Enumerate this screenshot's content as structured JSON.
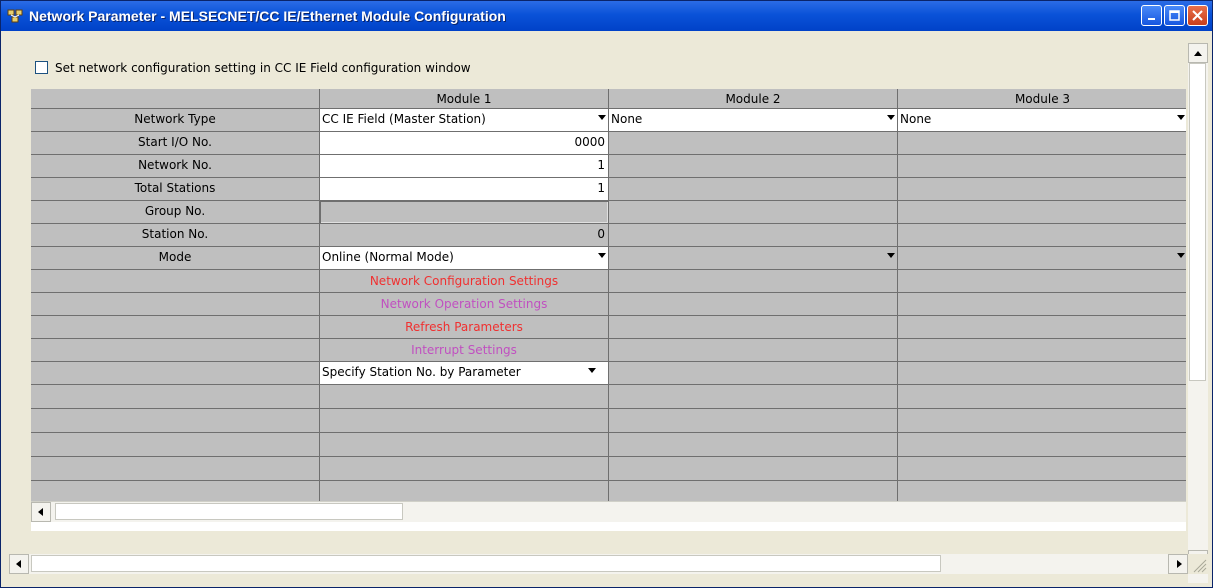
{
  "window": {
    "title": "Network Parameter - MELSECNET/CC IE/Ethernet Module Configuration"
  },
  "checkbox": {
    "label": "Set network configuration setting in CC IE Field configuration window",
    "checked": false
  },
  "table": {
    "columns": [
      "Module 1",
      "Module 2",
      "Module 3"
    ],
    "row_labels": [
      "Network Type",
      "Start I/O No.",
      "Network No.",
      "Total Stations",
      "Group No.",
      "Station No.",
      "Mode"
    ],
    "network_type": [
      "CC IE Field (Master Station)",
      "None",
      "None"
    ],
    "start_io_no": "0000",
    "network_no": "1",
    "total_stations": "1",
    "station_no": "0",
    "mode": "Online (Normal Mode)",
    "buttons": {
      "network_configuration": "Network Configuration Settings",
      "network_operation": "Network Operation Settings",
      "refresh_parameters": "Refresh Parameters",
      "interrupt_settings": "Interrupt Settings"
    },
    "station_spec": "Specify Station No. by Parameter"
  },
  "colors": {
    "red_link": "#f03030",
    "purple_link": "#c050c0",
    "title_bar": "#0a52d8"
  }
}
